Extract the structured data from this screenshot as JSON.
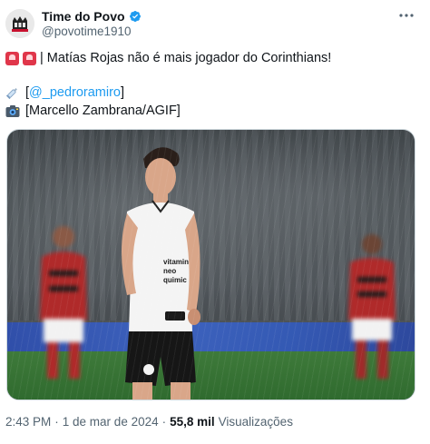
{
  "author": {
    "display_name": "Time do Povo",
    "handle": "@povotime1910",
    "verified": true,
    "avatar_icon": "team-crest-avatar"
  },
  "tweet": {
    "line1_emojis": [
      "police-siren-emoji",
      "police-siren-emoji"
    ],
    "line1_text": "| Matías Rojas não é mais jogador do Corinthians!",
    "line2_emoji": "syringe-emoji",
    "line2_prefix": "[",
    "line2_link": "@_pedroramiro",
    "line2_suffix": "]",
    "line3_emoji": "camera-emoji",
    "line3_text": "[Marcello Zambrana/AGIF]"
  },
  "meta": {
    "time": "2:43 PM",
    "separator": "·",
    "date": "1 de mar de 2024",
    "views_count": "55,8 mil",
    "views_label": "Visualizações"
  },
  "colors": {
    "link": "#1d9bf0",
    "verified": "#1d9bf0",
    "secondary_text": "#536471"
  }
}
